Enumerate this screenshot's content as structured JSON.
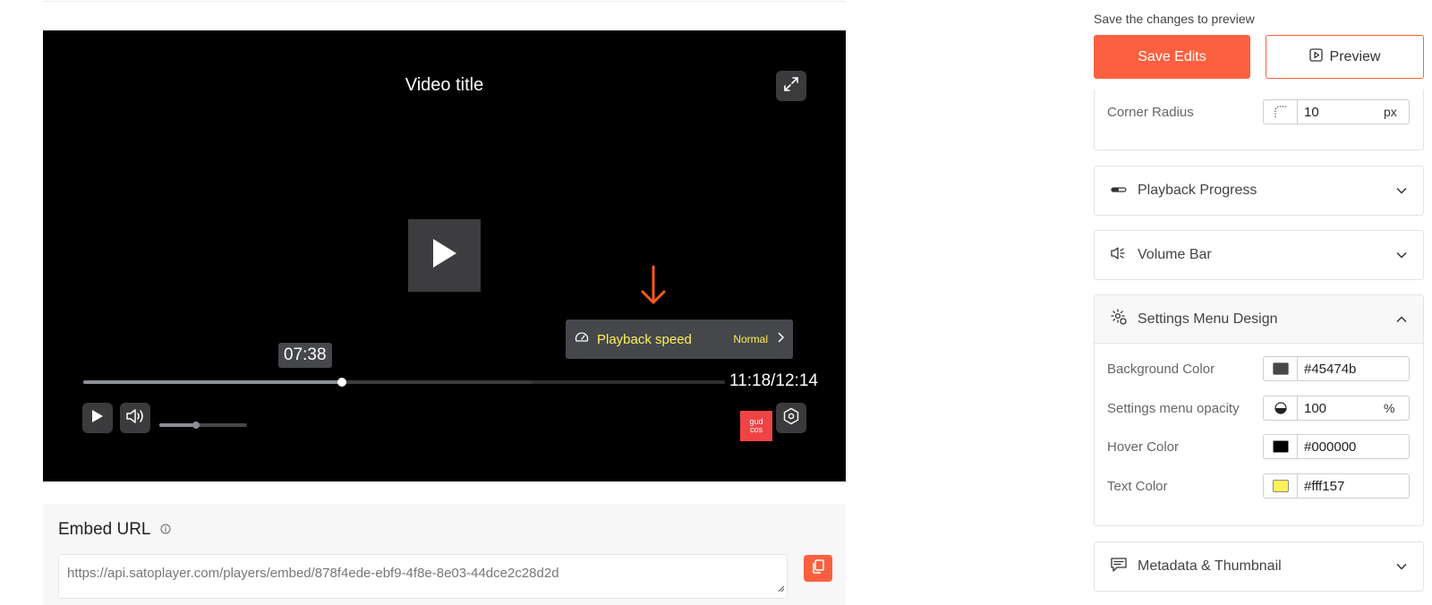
{
  "player": {
    "title": "Video title",
    "tooltip_time": "07:38",
    "timecode": "11:18/12:14",
    "progress_fraction": 0.403,
    "buffered_fraction": 0.7,
    "volume_fraction": 0.42,
    "logo_line1": "gud",
    "logo_line2": "cos",
    "speed_menu": {
      "label": "Playback speed",
      "value": "Normal"
    },
    "colors": {
      "menu_background": "#45474b",
      "menu_text": "#fff157",
      "accent_arrow": "#fb5a1e"
    }
  },
  "embed": {
    "title": "Embed URL",
    "url": "https://api.satoplayer.com/players/embed/878f4ede-ebf9-4f8e-8e03-44dce2c28d2d"
  },
  "panel": {
    "hint": "Save the changes to preview",
    "save_label": "Save Edits",
    "preview_label": "Preview",
    "corner_radius": {
      "label": "Corner Radius",
      "value": "10",
      "unit": "px"
    },
    "sections": {
      "playback_progress": "Playback Progress",
      "volume_bar": "Volume Bar",
      "settings_menu_design": "Settings Menu Design",
      "metadata_thumbnail": "Metadata & Thumbnail"
    },
    "settings_menu": {
      "background": {
        "label": "Background Color",
        "value": "#45474b",
        "swatch": "#45474b"
      },
      "opacity": {
        "label": "Settings menu opacity",
        "value": "100",
        "unit": "%"
      },
      "hover": {
        "label": "Hover Color",
        "value": "#000000",
        "swatch": "#000000"
      },
      "text": {
        "label": "Text Color",
        "value": "#fff157",
        "swatch": "#fff157"
      }
    },
    "colors": {
      "accent": "#fb6140"
    }
  }
}
